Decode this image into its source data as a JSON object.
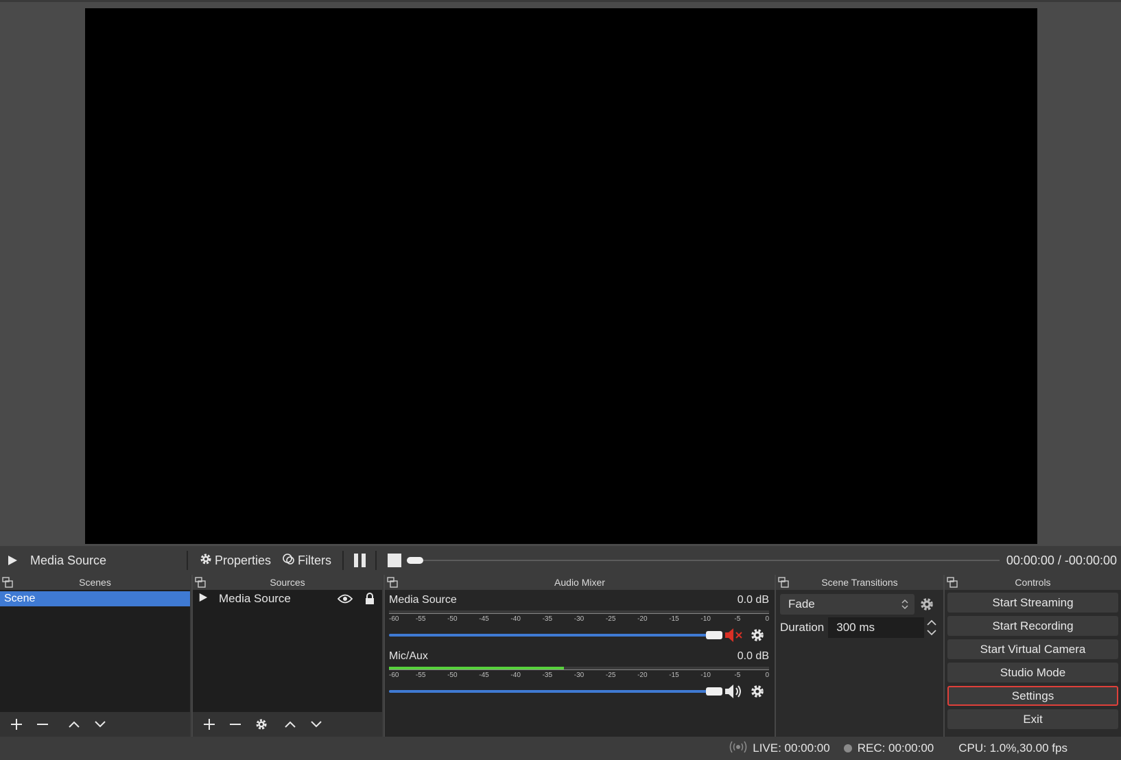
{
  "media_bar": {
    "source_name": "Media Source",
    "properties_label": "Properties",
    "filters_label": "Filters",
    "time": "00:00:00 / -00:00:00"
  },
  "docks": {
    "scenes": {
      "title": "Scenes",
      "items": [
        "Scene"
      ]
    },
    "sources": {
      "title": "Sources",
      "items": [
        {
          "name": "Media Source"
        }
      ]
    },
    "mixer": {
      "title": "Audio Mixer",
      "channels": [
        {
          "name": "Media Source",
          "db": "0.0 dB",
          "muted": true,
          "level": 0
        },
        {
          "name": "Mic/Aux",
          "db": "0.0 dB",
          "muted": false,
          "level": 0.46
        }
      ],
      "scale_ticks": [
        "-60",
        "-55",
        "-50",
        "-45",
        "-40",
        "-35",
        "-30",
        "-25",
        "-20",
        "-15",
        "-10",
        "-5",
        "0"
      ]
    },
    "transitions": {
      "title": "Scene Transitions",
      "selected": "Fade",
      "duration_label": "Duration",
      "duration_value": "300 ms"
    },
    "controls": {
      "title": "Controls",
      "buttons": [
        "Start Streaming",
        "Start Recording",
        "Start Virtual Camera",
        "Studio Mode",
        "Settings",
        "Exit"
      ]
    }
  },
  "status": {
    "live": "LIVE: 00:00:00",
    "rec": "REC: 00:00:00",
    "cpu": "CPU: 1.0%,30.00 fps"
  },
  "colors": {
    "accent": "#3f7ad3",
    "highlight": "#e0403a",
    "meter_green": "#57d13c",
    "muted_red": "#d93025"
  }
}
